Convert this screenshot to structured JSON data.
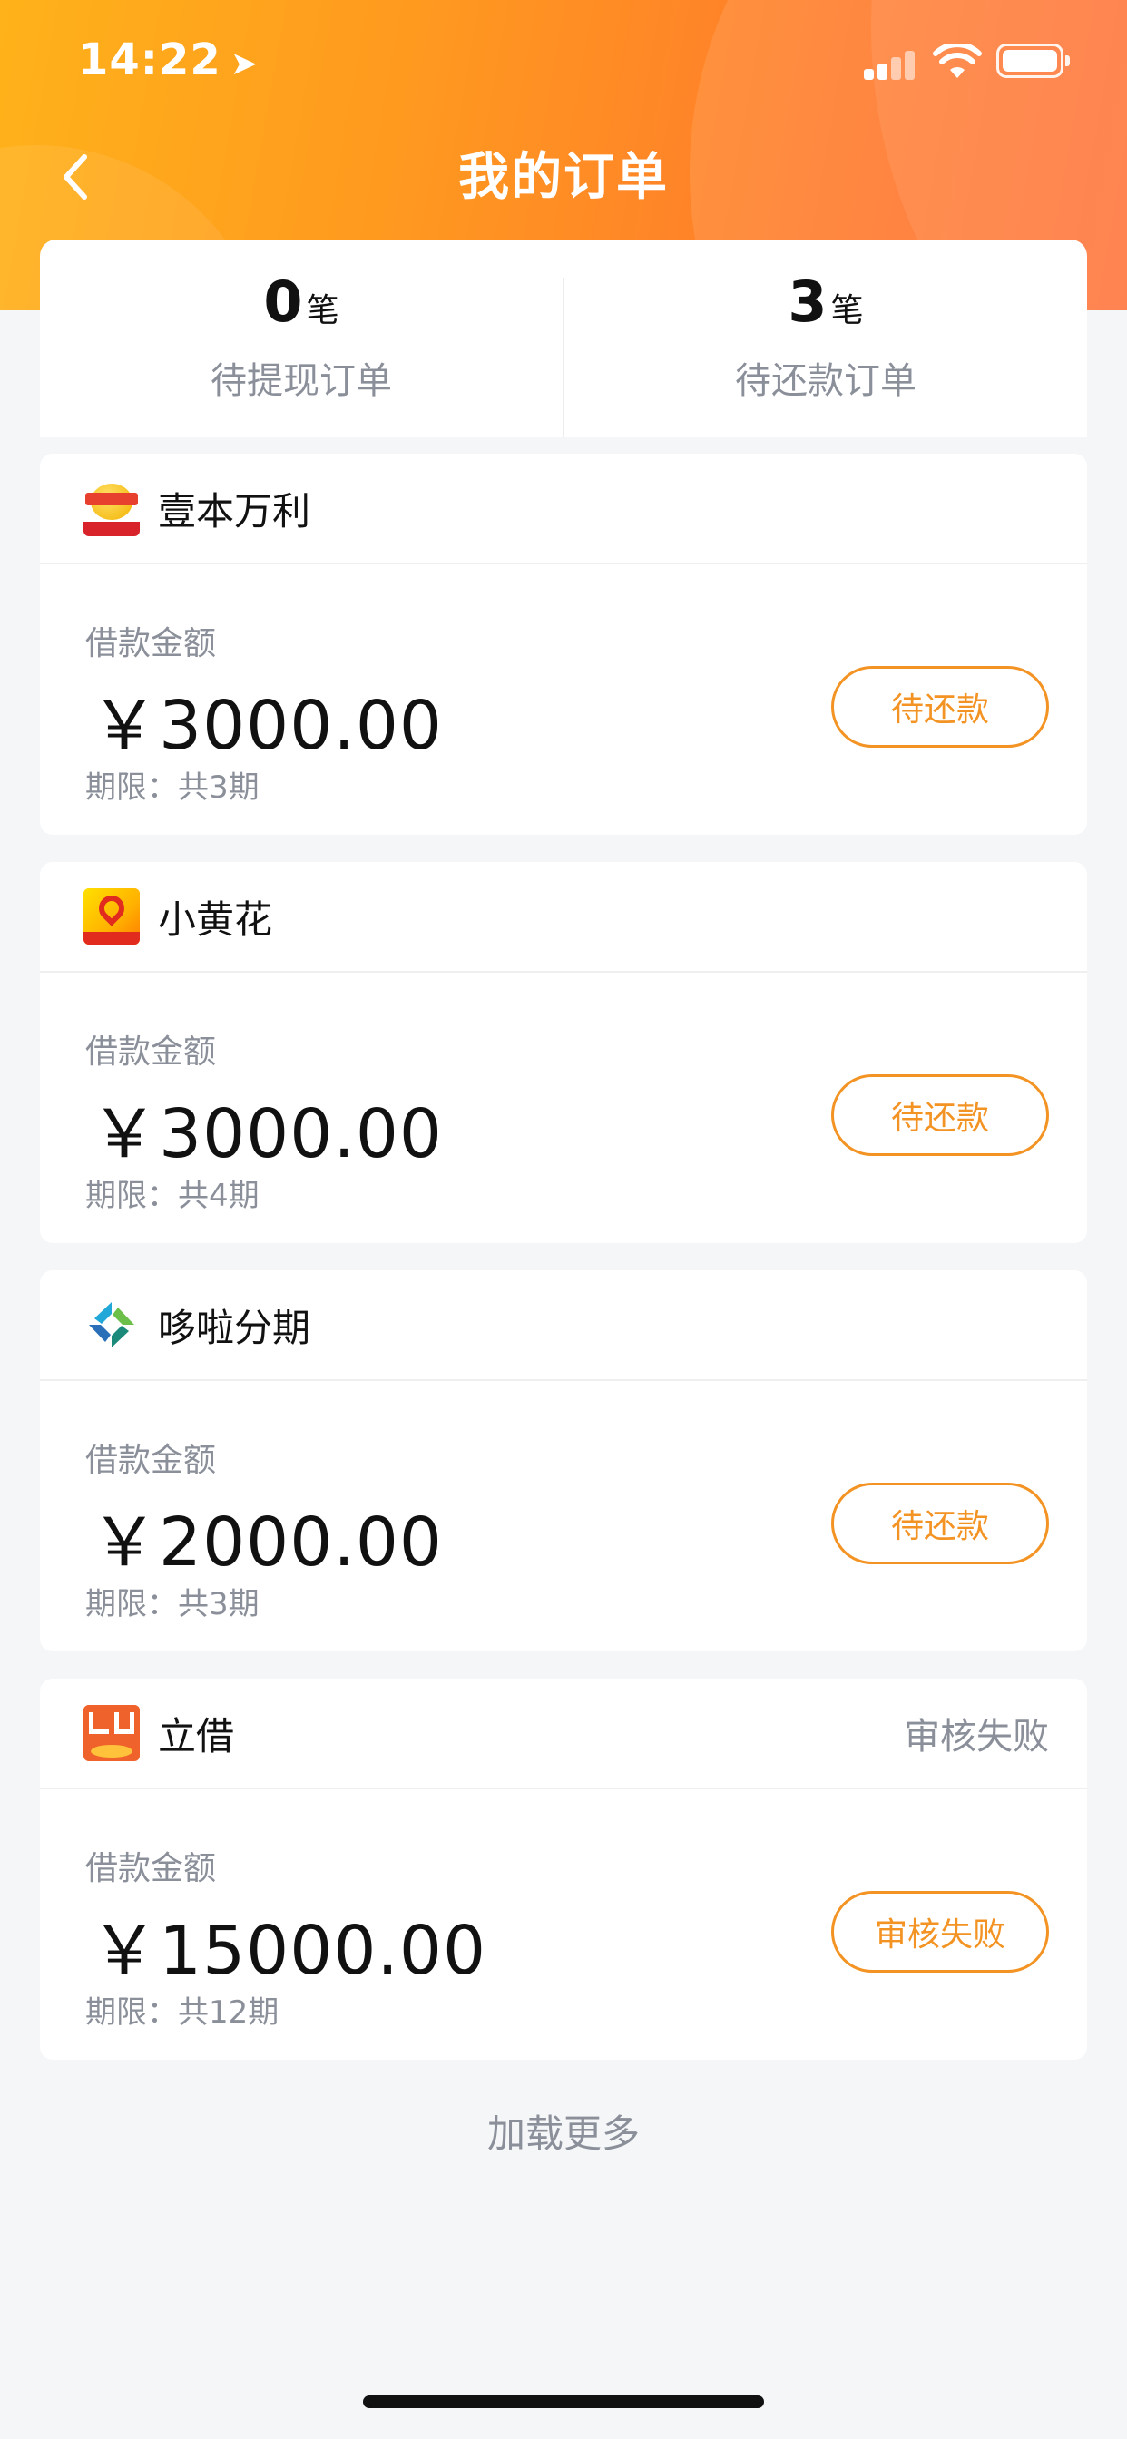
{
  "status_bar": {
    "time": "14:22"
  },
  "nav": {
    "title": "我的订单"
  },
  "summary": [
    {
      "count": "0",
      "unit": "笔",
      "label": "待提现订单"
    },
    {
      "count": "3",
      "unit": "笔",
      "label": "待还款订单"
    }
  ],
  "orders": [
    {
      "brand": "壹本万利",
      "status_text": "",
      "amount_label": "借款金额",
      "amount": "￥3000.00",
      "term": "期限：共3期",
      "action": "待还款",
      "logo_icon": "yibenwanli-logo-icon"
    },
    {
      "brand": "小黄花",
      "status_text": "",
      "amount_label": "借款金额",
      "amount": "￥3000.00",
      "term": "期限：共4期",
      "action": "待还款",
      "logo_icon": "xiaohuanghua-logo-icon"
    },
    {
      "brand": "哆啦分期",
      "status_text": "",
      "amount_label": "借款金额",
      "amount": "￥2000.00",
      "term": "期限：共3期",
      "action": "待还款",
      "logo_icon": "duola-logo-icon"
    },
    {
      "brand": "立借",
      "status_text": "审核失败",
      "amount_label": "借款金额",
      "amount": "￥15000.00",
      "term": "期限：共12期",
      "action": "审核失败",
      "logo_icon": "lijie-logo-icon"
    }
  ],
  "load_more": "加载更多",
  "colors": {
    "accent": "#f39323",
    "header_start": "#ffb21a",
    "header_end": "#ff6a2e",
    "muted_text": "#8a8f99"
  }
}
